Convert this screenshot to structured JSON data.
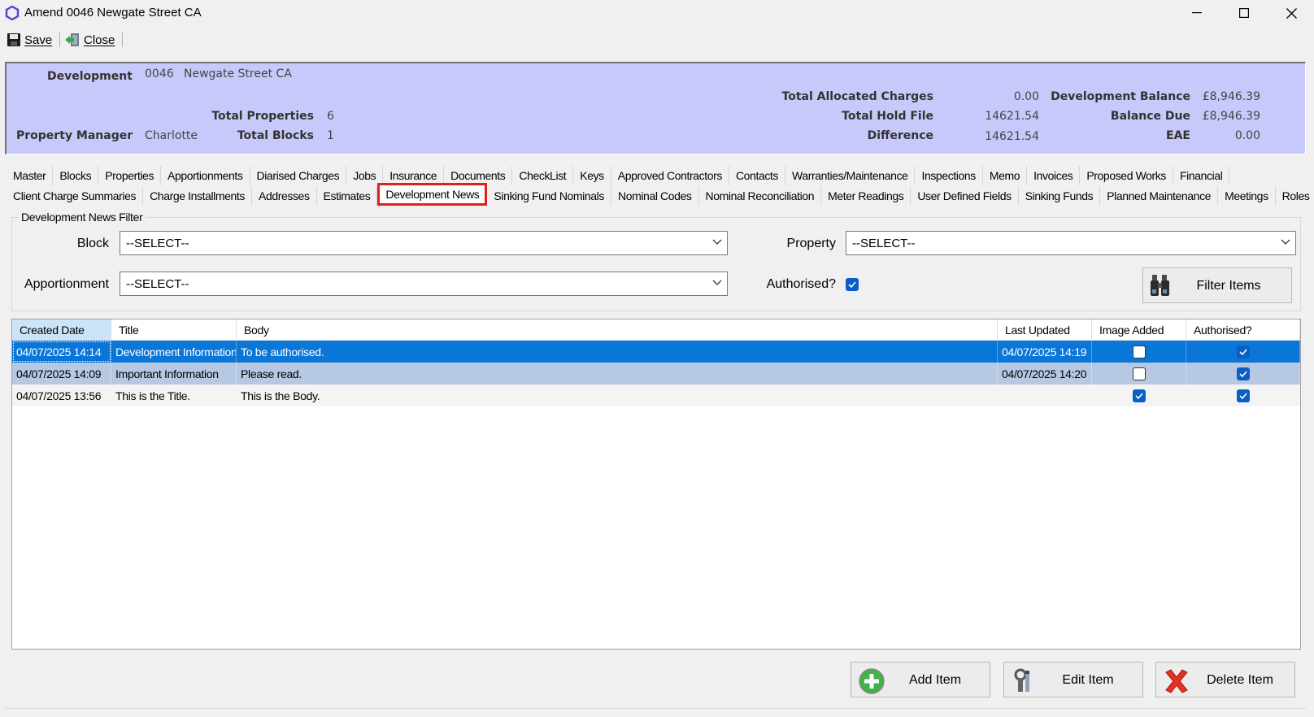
{
  "window": {
    "title": "Amend 0046 Newgate Street CA"
  },
  "toolbar": {
    "save_label": "Save",
    "close_label": "Close"
  },
  "header": {
    "development_label": "Development",
    "development_code": "0046",
    "development_name": "Newgate Street CA",
    "total_properties_label": "Total Properties",
    "total_properties": "6",
    "property_manager_label": "Property Manager",
    "property_manager": "Charlotte",
    "total_blocks_label": "Total Blocks",
    "total_blocks": "1",
    "total_allocated_charges_label": "Total Allocated Charges",
    "total_allocated_charges": "0.00",
    "total_hold_file_label": "Total Hold File",
    "total_hold_file": "14621.54",
    "difference_label": "Difference",
    "difference": "14621.54",
    "development_balance_label": "Development Balance",
    "development_balance": "£8,946.39",
    "balance_due_label": "Balance Due",
    "balance_due": "£8,946.39",
    "eae_label": "EAE",
    "eae": "0.00"
  },
  "tabs_row1": [
    "Master",
    "Blocks",
    "Properties",
    "Apportionments",
    "Diarised Charges",
    "Jobs",
    "Insurance",
    "Documents",
    "CheckList",
    "Keys",
    "Approved Contractors",
    "Contacts",
    "Warranties/Maintenance",
    "Inspections",
    "Memo",
    "Invoices",
    "Proposed Works",
    "Financial"
  ],
  "tabs_row2": [
    "Client Charge Summaries",
    "Charge Installments",
    "Addresses",
    "Estimates",
    "Development News",
    "Sinking Fund Nominals",
    "Nominal Codes",
    "Nominal Reconciliation",
    "Meter Readings",
    "User Defined Fields",
    "Sinking Funds",
    "Planned Maintenance",
    "Meetings",
    "Roles"
  ],
  "active_tab": "Development News",
  "filter": {
    "group_title": "Development News Filter",
    "block_label": "Block",
    "block_value": "--SELECT--",
    "property_label": "Property",
    "property_value": "--SELECT--",
    "apportionment_label": "Apportionment",
    "apportionment_value": "--SELECT--",
    "authorised_label": "Authorised?",
    "authorised_checked": true,
    "filter_button": "Filter Items"
  },
  "grid": {
    "columns": [
      "Created Date",
      "Title",
      "Body",
      "Last Updated",
      "Image Added",
      "Authorised?"
    ],
    "rows": [
      {
        "created": "04/07/2025 14:14",
        "title": "Development Information",
        "body": "To be authorised.",
        "updated": "04/07/2025 14:19",
        "image_added": false,
        "authorised": true
      },
      {
        "created": "04/07/2025 14:09",
        "title": "Important Information",
        "body": "Please read.",
        "updated": "04/07/2025 14:20",
        "image_added": false,
        "authorised": true
      },
      {
        "created": "04/07/2025 13:56",
        "title": "This is the Title.",
        "body": "This is the Body.",
        "updated": "",
        "image_added": true,
        "authorised": true
      }
    ]
  },
  "actions": {
    "add_label": "Add Item",
    "edit_label": "Edit Item",
    "delete_label": "Delete Item"
  },
  "colors": {
    "header_panel": "#c8c9fb",
    "selected_row": "#0a76d8",
    "alt_row": "#b6c8e2",
    "active_tab_border": "#e0201a",
    "checkbox": "#0a5fc4"
  }
}
